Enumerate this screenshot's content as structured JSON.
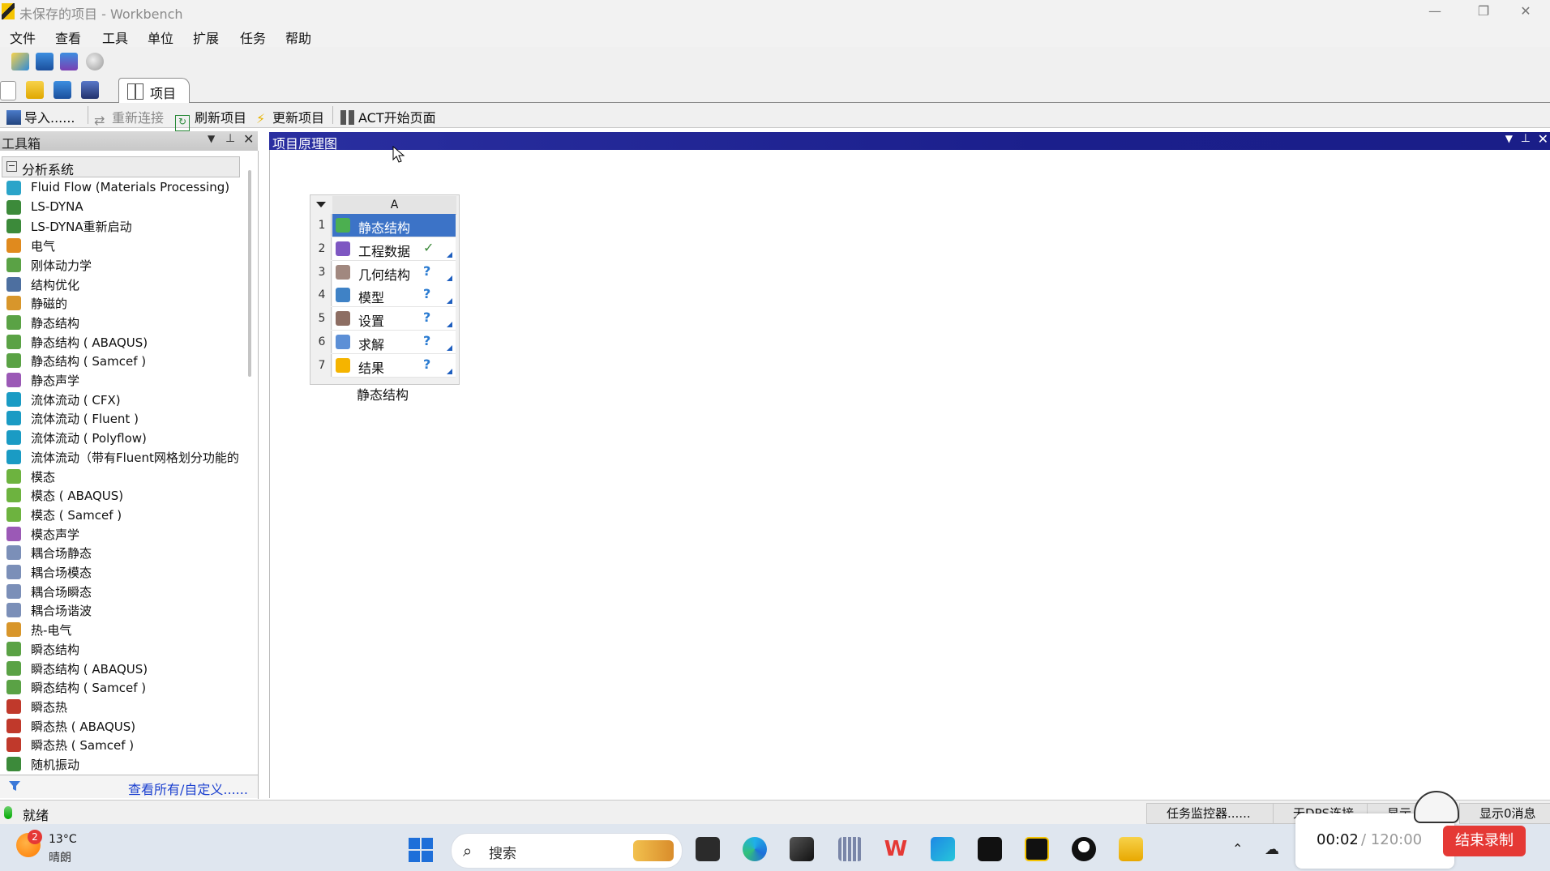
{
  "window": {
    "title": "未保存的项目 - Workbench"
  },
  "menu": [
    "文件",
    "查看",
    "工具",
    "单位",
    "扩展",
    "任务",
    "帮助"
  ],
  "tab": {
    "label": "项目"
  },
  "toolbar2": {
    "import": "导入......",
    "reconnect": "重新连接",
    "refresh": "刷新项目",
    "update": "更新项目",
    "act": "ACT开始页面"
  },
  "toolbox": {
    "title": "工具箱",
    "category": "分析系统",
    "items": [
      "Fluid Flow (Materials Processing)",
      "LS-DYNA",
      "LS-DYNA重新启动",
      "电气",
      "刚体动力学",
      "结构优化",
      "静磁的",
      "静态结构",
      "静态结构 ( ABAQUS)",
      "静态结构 ( Samcef )",
      "静态声学",
      "流体流动 ( CFX)",
      "流体流动 ( Fluent )",
      "流体流动 ( Polyflow)",
      "流体流动（带有Fluent网格划分功能的",
      "模态",
      "模态 ( ABAQUS)",
      "模态 ( Samcef )",
      "模态声学",
      "耦合场静态",
      "耦合场模态",
      "耦合场瞬态",
      "耦合场谐波",
      "热-电气",
      "瞬态结构",
      "瞬态结构 ( ABAQUS)",
      "瞬态结构 ( Samcef )",
      "瞬态热",
      "瞬态热 ( ABAQUS)",
      "瞬态热 ( Samcef )",
      "随机振动"
    ],
    "footer_link": "查看所有/自定义......"
  },
  "schematic": {
    "title": "项目原理图",
    "column": "A",
    "caption": "静态结构",
    "rows": [
      {
        "num": "1",
        "label": "静态结构",
        "status": ""
      },
      {
        "num": "2",
        "label": "工程数据",
        "status": "✓"
      },
      {
        "num": "3",
        "label": "几何结构",
        "status": "?"
      },
      {
        "num": "4",
        "label": "模型",
        "status": "?"
      },
      {
        "num": "5",
        "label": "设置",
        "status": "?"
      },
      {
        "num": "6",
        "label": "求解",
        "status": "?"
      },
      {
        "num": "7",
        "label": "结果",
        "status": "?"
      }
    ]
  },
  "statusbar": {
    "status": "就绪",
    "task_monitor": "任务监控器......",
    "dps": "无DPS连接",
    "show": "显示",
    "messages": "显示0消息"
  },
  "taskbar": {
    "weather_badge": "2",
    "temperature": "13°C",
    "condition": "晴朗",
    "search_placeholder": "搜索"
  },
  "recorder": {
    "elapsed": "00:02",
    "total": "/ 120:00",
    "stop_label": "结束录制"
  }
}
